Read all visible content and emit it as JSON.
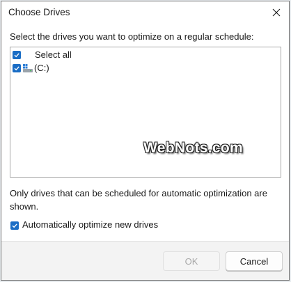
{
  "dialog": {
    "title": "Choose Drives",
    "prompt": "Select the drives you want to optimize on a regular schedule:",
    "drives": [
      {
        "label": "Select all",
        "checked": true
      },
      {
        "label": "(C:)",
        "checked": true,
        "icon": "drive-icon"
      }
    ],
    "note": "Only drives that can be scheduled for automatic optimization are shown.",
    "auto_optimize": {
      "label": "Automatically optimize new drives",
      "checked": true
    },
    "ok_label": "OK",
    "cancel_label": "Cancel",
    "watermark": "WebNots.com"
  },
  "colors": {
    "accent": "#1a6dc5",
    "footer": "#f3f3f3",
    "disabled_text": "#a8a8a8"
  }
}
